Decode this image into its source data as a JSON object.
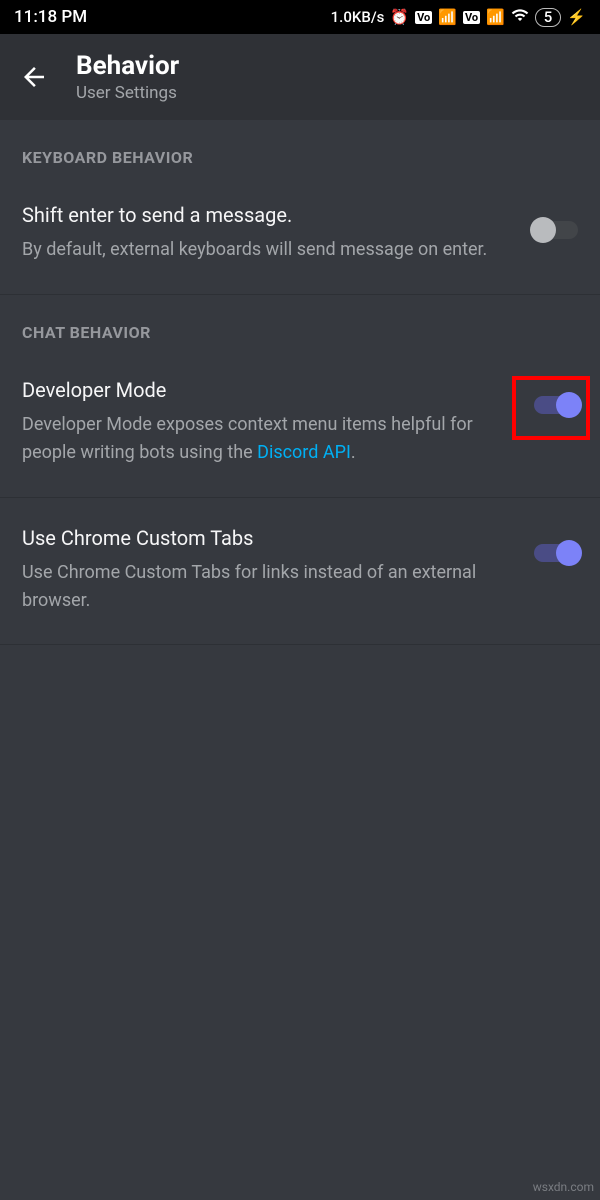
{
  "status": {
    "time": "11:18 PM",
    "net_speed": "1.0KB/s",
    "battery": "5"
  },
  "header": {
    "title": "Behavior",
    "subtitle": "User Settings"
  },
  "sections": {
    "keyboard": {
      "label": "KEYBOARD BEHAVIOR",
      "shift_enter": {
        "title": "Shift enter to send a message.",
        "desc": "By default, external keyboards will send message on enter."
      }
    },
    "chat": {
      "label": "CHAT BEHAVIOR",
      "dev_mode": {
        "title": "Developer Mode",
        "desc_pre": "Developer Mode exposes context menu items helpful for people writing bots using the ",
        "link_text": "Discord API",
        "desc_post": "."
      },
      "chrome_tabs": {
        "title": "Use Chrome Custom Tabs",
        "desc": "Use Chrome Custom Tabs for links instead of an external browser."
      }
    }
  },
  "watermark": "wsxdn.com"
}
